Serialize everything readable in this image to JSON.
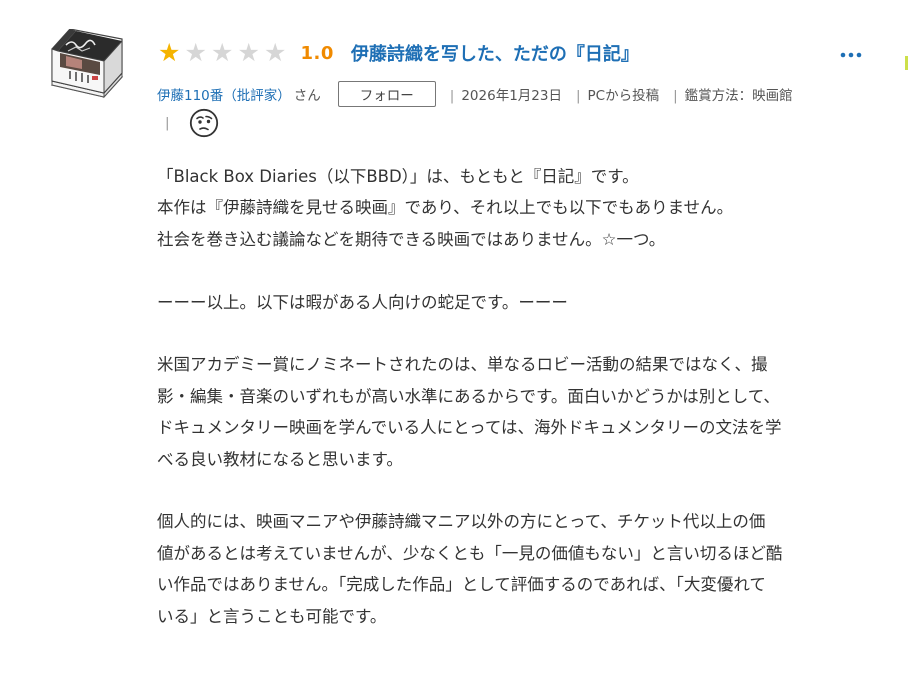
{
  "review": {
    "rating_value": "1.0",
    "rating_stars_filled": 1,
    "rating_stars_total": 5,
    "title": "伊藤詩織を写した、ただの『日記』",
    "more_label": "…"
  },
  "author": {
    "name": "伊藤110番（批評家）",
    "honorific": "さん",
    "follow_label": "フォロー"
  },
  "meta": {
    "date": "2026年1月23日",
    "post_source": "PCから投稿",
    "viewing_method": "鑑賞方法：映画館",
    "separator": "|",
    "emotion_icon": "skeptical-face-icon"
  },
  "body": {
    "paragraphs": [
      "「Black Box Diaries（以下BBD）」は、もともと『日記』です。\n本作は『伊藤詩織を見せる映画』であり、それ以上でも以下でもありません。\n社会を巻き込む議論などを期待できる映画ではありません。☆一つ。",
      "ーーー以上。以下は暇がある人向けの蛇足です。ーーー",
      "米国アカデミー賞にノミネートされたのは、単なるロビー活動の結果ではなく、撮\n影・編集・音楽のいずれもが高い水準にあるからです。面白いかどうかは別として、\nドキュメンタリー映画を学んでいる人にとっては、海外ドキュメンタリーの文法を学\nべる良い教材になると思います。",
      "個人的には、映画マニアや伊藤詩織マニア以外の方にとって、チケット代以上の価\n値があるとは考えていませんが、少なくとも「一見の価値もない」と言い切るほど酷\nい作品ではありません。「完成した作品」として評価するのであれば、「大変優れて\nいる」と言うことも可能です。"
    ]
  },
  "colors": {
    "star_on": "#f5b400",
    "star_off": "#d6d6d6",
    "score": "#f08a00",
    "link": "#1e6fb5",
    "text": "#333333"
  }
}
